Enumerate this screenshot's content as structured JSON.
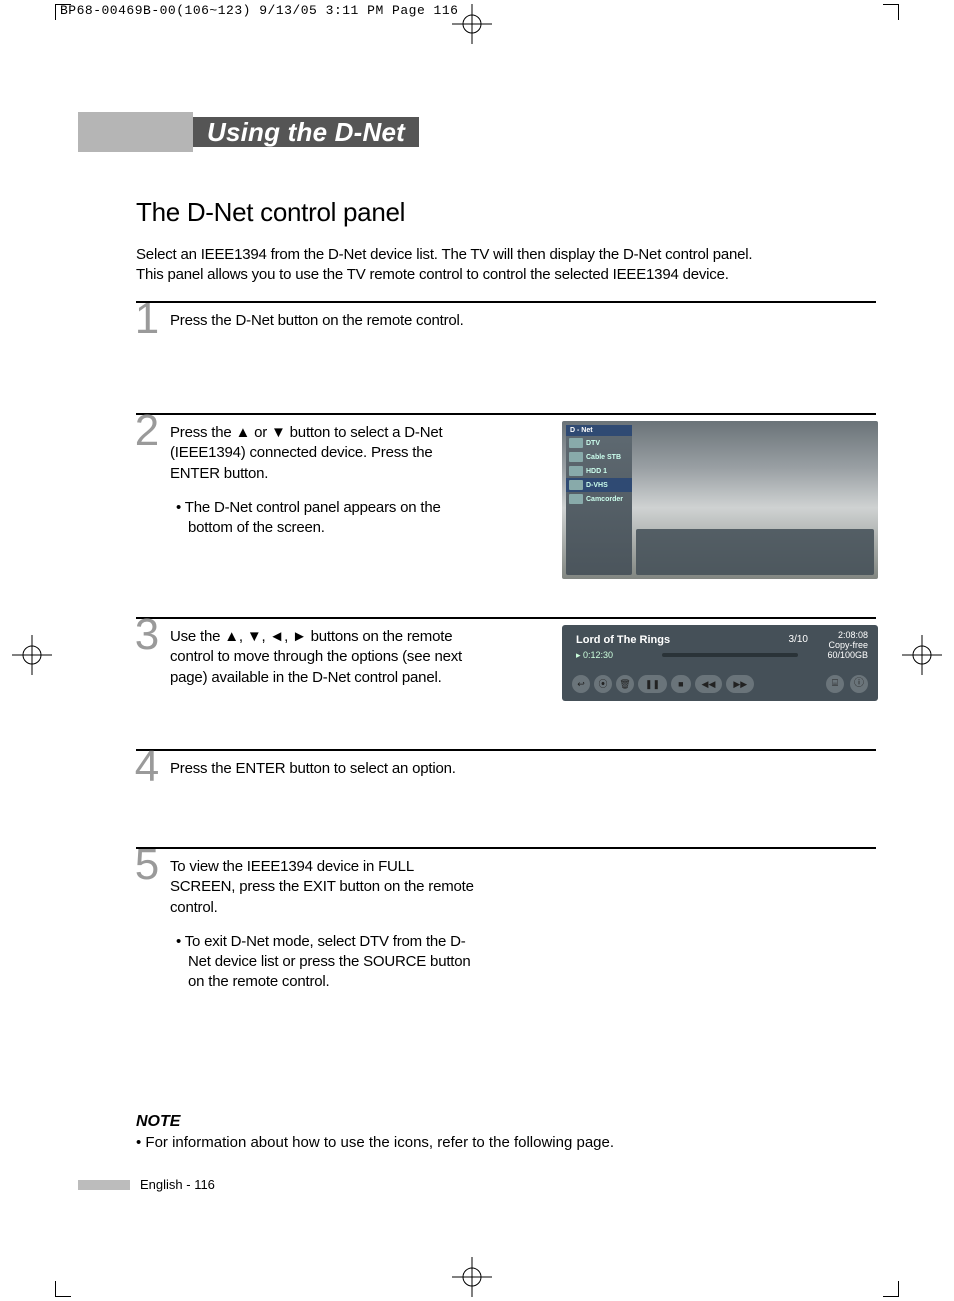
{
  "header_line": "BP68-00469B-00(106~123)  9/13/05  3:11 PM  Page 116",
  "title": "Using the D-Net",
  "section_heading": "The D-Net control panel",
  "intro_line1": "Select an IEEE1394 from the D-Net device list. The TV will then display the D-Net control panel.",
  "intro_line2": "This panel allows you to use the TV remote control to control the selected IEEE1394 device.",
  "steps": {
    "1": {
      "num": "1",
      "text": "Press the D-Net button on the remote control."
    },
    "2": {
      "num": "2",
      "text": "Press the ▲ or ▼ button to select a D-Net (IEEE1394) connected device. Press the ENTER button.",
      "sub": "• The D-Net control panel appears on the bottom of the screen."
    },
    "3": {
      "num": "3",
      "text": "Use the ▲, ▼, ◄, ► buttons on the remote control to move through the options (see next page) available in the D-Net control panel."
    },
    "4": {
      "num": "4",
      "text": "Press the ENTER button to select an option."
    },
    "5": {
      "num": "5",
      "text": "To view the IEEE1394 device in FULL SCREEN, press the EXIT button on the remote control.",
      "sub": "• To exit D-Net mode, select DTV from the D-Net device list or press the SOURCE button on the remote control."
    }
  },
  "note": {
    "label": "NOTE",
    "text": "• For information about how to use the icons, refer to the following page."
  },
  "footer": "English - 116",
  "mock": {
    "side_header": "D - Net",
    "side_items": [
      "DTV",
      "Cable STB",
      "HDD 1",
      "D-VHS",
      "Camcorder"
    ],
    "panel_title": "Lord of The Rings",
    "panel_count": "3/10",
    "panel_dur": "2:08:08",
    "panel_copy": "Copy-free",
    "panel_size": "60/100GB",
    "panel_time": "0:12:30",
    "ctrl_icons": [
      "↩",
      "⦿",
      "🗑",
      "❚❚",
      "■",
      "◀◀",
      "▶▶"
    ],
    "rctrl_icons": [
      "⌸",
      "ⓘ"
    ]
  }
}
